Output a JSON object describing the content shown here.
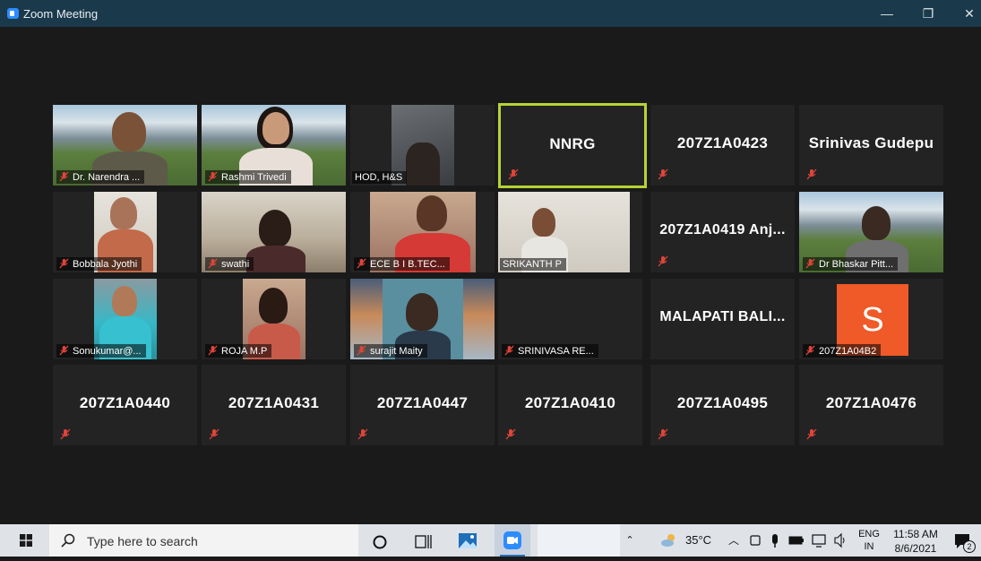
{
  "window": {
    "title": "Zoom Meeting",
    "minimize": "—",
    "restore": "❐",
    "close": "✕"
  },
  "tiles": [
    {
      "label": "Dr. Narendra ...",
      "type": "video"
    },
    {
      "label": "Rashmi Trivedi",
      "type": "video"
    },
    {
      "label": "HOD, H&S",
      "type": "video"
    },
    {
      "label": "NNRG",
      "type": "name",
      "active": true
    },
    {
      "label": "207Z1A0423",
      "type": "name"
    },
    {
      "label": "Srinivas Gudepu",
      "type": "name"
    },
    {
      "label": "Bobbala Jyothi",
      "type": "video"
    },
    {
      "label": "swathi",
      "type": "video"
    },
    {
      "label": "ECE B I B.TEC...",
      "type": "video"
    },
    {
      "label": "SRIKANTH P",
      "type": "video"
    },
    {
      "label": "207Z1A0419  Anj...",
      "type": "name"
    },
    {
      "label": "Dr Bhaskar Pitt...",
      "type": "video"
    },
    {
      "label": "Sonukumar@...",
      "type": "video"
    },
    {
      "label": "ROJA M.P",
      "type": "video"
    },
    {
      "label": "surajit Maity",
      "type": "video"
    },
    {
      "label": "SRINIVASA RE...",
      "type": "blank"
    },
    {
      "label": "MALAPATI  BALI...",
      "type": "name"
    },
    {
      "label": "207Z1A04B2",
      "type": "avatar",
      "initial": "S"
    },
    {
      "label": "207Z1A0440",
      "type": "name"
    },
    {
      "label": "207Z1A0431",
      "type": "name"
    },
    {
      "label": "207Z1A0447",
      "type": "name"
    },
    {
      "label": "207Z1A0410",
      "type": "name"
    },
    {
      "label": "207Z1A0495",
      "type": "name"
    },
    {
      "label": "207Z1A0476",
      "type": "name"
    }
  ],
  "taskbar": {
    "search_placeholder": "Type here to search",
    "weather": "35°C",
    "lang_top": "ENG",
    "lang_bottom": "IN",
    "time": "11:58 AM",
    "date": "8/6/2021",
    "notifications": "2",
    "icons": [
      "windows-start-icon",
      "search-icon",
      "cortana-icon",
      "task-view-icon",
      "photos-icon",
      "zoom-icon"
    ]
  },
  "colors": {
    "active_speaker": "#b5d334",
    "muted_red": "#e0443a",
    "avatar_orange": "#ef5a28"
  }
}
